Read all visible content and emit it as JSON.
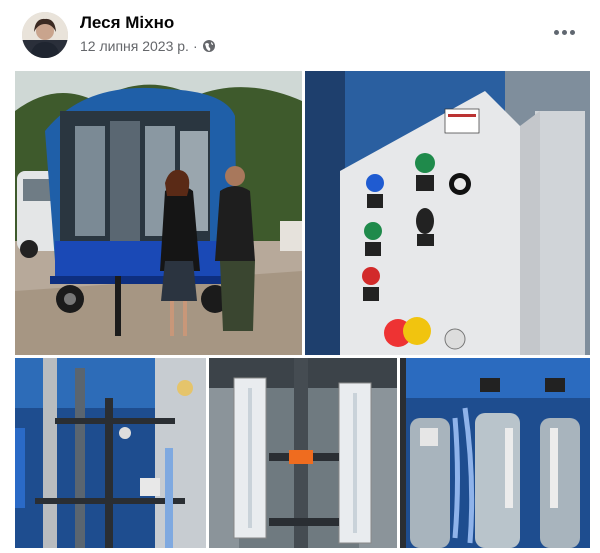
{
  "post": {
    "author": "Леся Міхно",
    "date": "12 липня 2023 р.",
    "separator": "·",
    "audience_icon": "globe-icon",
    "more_icon": "more-options-icon"
  },
  "photos": [
    {
      "id": "photo-1",
      "subject": "trailer"
    },
    {
      "id": "photo-2",
      "subject": "control-panel"
    },
    {
      "id": "photo-3",
      "subject": "pipes"
    },
    {
      "id": "photo-4",
      "subject": "flowmeters"
    },
    {
      "id": "photo-5",
      "subject": "tanks"
    }
  ],
  "colors": {
    "author_text": "#050505",
    "meta_text": "#65676b",
    "tarp_blue": "#1f5fa8",
    "trailer_blue": "#1a49b6",
    "panel_gray": "#e7e8ea",
    "button_green": "#1f8a4b",
    "button_blue": "#1f5bd1",
    "button_red": "#d22a2a"
  }
}
